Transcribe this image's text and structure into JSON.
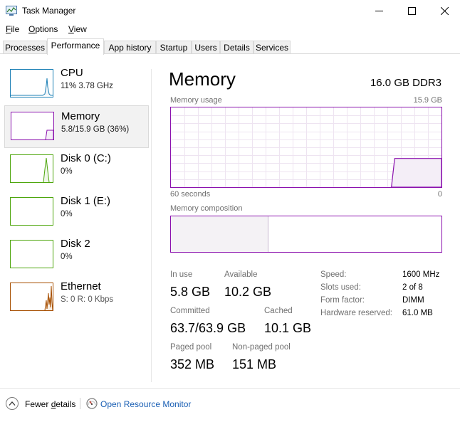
{
  "window": {
    "title": "Task Manager"
  },
  "menu": {
    "file": "File",
    "options": "Options",
    "view": "View"
  },
  "tabs": [
    "Processes",
    "Performance",
    "App history",
    "Startup",
    "Users",
    "Details",
    "Services"
  ],
  "active_tab": "Performance",
  "sidebar": {
    "items": [
      {
        "name": "CPU",
        "detail": "11%  3.78 GHz",
        "color": "#1d80b6"
      },
      {
        "name": "Memory",
        "detail": "5.8/15.9 GB (36%)",
        "color": "#8b12ae"
      },
      {
        "name": "Disk 0 (C:)",
        "detail": "0%",
        "color": "#4da60c"
      },
      {
        "name": "Disk 1 (E:)",
        "detail": "0%",
        "color": "#4da60c"
      },
      {
        "name": "Disk 2",
        "detail": "0%",
        "color": "#4da60c"
      },
      {
        "name": "Ethernet",
        "detail": "S: 0 R: 0 Kbps",
        "color": "#a74f01"
      }
    ],
    "selected": "Memory"
  },
  "main": {
    "title": "Memory",
    "spec": "16.0 GB DDR3",
    "usage_label": "Memory usage",
    "usage_max": "15.9 GB",
    "time_label": "60 seconds",
    "time_end": "0",
    "composition_label": "Memory composition",
    "composition_in_use_fraction": 0.36,
    "stats": {
      "in_use_label": "In use",
      "in_use": "5.8 GB",
      "available_label": "Available",
      "available": "10.2 GB",
      "committed_label": "Committed",
      "committed": "63.7/63.9 GB",
      "cached_label": "Cached",
      "cached": "10.1 GB",
      "paged_label": "Paged pool",
      "paged": "352 MB",
      "nonpaged_label": "Non-paged pool",
      "nonpaged": "151 MB"
    },
    "specs": {
      "speed_label": "Speed:",
      "speed": "1600 MHz",
      "slots_label": "Slots used:",
      "slots": "2 of 8",
      "form_label": "Form factor:",
      "form": "DIMM",
      "reserved_label": "Hardware reserved:",
      "reserved": "61.0 MB"
    },
    "usage_level_fraction": 0.36
  },
  "footer": {
    "fewer_details": "Fewer details",
    "open_rm": "Open Resource Monitor"
  }
}
